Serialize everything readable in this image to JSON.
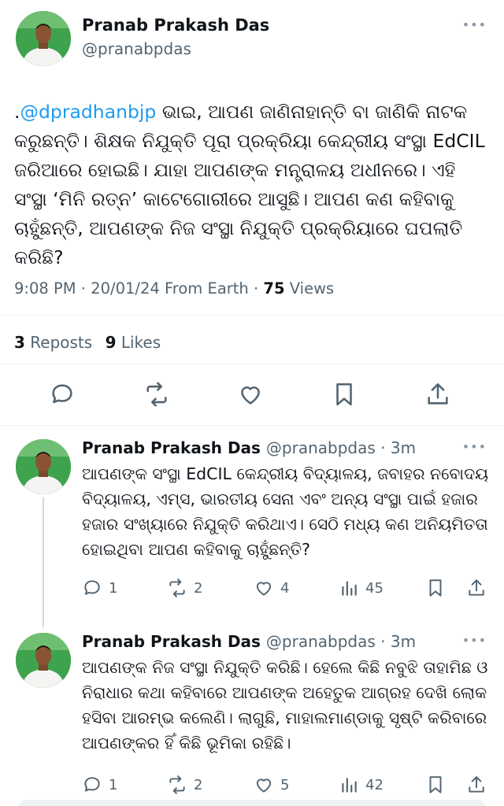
{
  "main_tweet": {
    "author_name": "Pranab Prakash Das",
    "author_handle": "@pranabpdas",
    "more_label": "•••",
    "text_prefix": ".",
    "mention": "@dpradhanbjp",
    "text_body": " ଭାଇ, ଆପଣ ଜାଣିନାହାନ୍ତି ବା ଜାଣିକି ନାଟକ କରୁଛନ୍ତି। ଶିକ୍ଷକ ନିଯୁକ୍ତି ପୂରା ପ୍ରକ୍ରିୟା କେନ୍ଦ୍ରୀୟ ସଂସ୍ଥା EdCIL ଜରିଆରେ ହୋଇଛି। ଯାହା ଆପଣଙ୍କ ମନ୍ତ୍ରାଳୟ ଅଧୀନରେ। ଏହି ସଂସ୍ଥା ‘ମିନି ରତ୍ନ’ କାଟେଗୋରୀରେ ଆସୁଛି। ଆପଣ କଣ କହିବାକୁ ଚାହୁଁଛନ୍ତି, ଆପଣଙ୍କ ନିଜ ସଂସ୍ଥା ନିଯୁକ୍ତି ପ୍ରକ୍ରିୟାରେ ଘପଲାତି କରିଛି?",
    "time": "9:08 PM",
    "date": "20/01/24",
    "source": "From Earth",
    "views_count": "75",
    "views_label": "Views",
    "reposts_count": "3",
    "reposts_label": "Reposts",
    "likes_count": "9",
    "likes_label": "Likes"
  },
  "replies": [
    {
      "author_name": "Pranab Prakash Das",
      "handle_time": "@pranabpdas · 3m",
      "text": "ଆପଣଙ୍କ ସଂସ୍ଥା EdCIL କେନ୍ଦ୍ରୀୟ ବିଦ୍ୟାଳୟ, ଜବାହର ନବୋଦୟ ବିଦ୍ୟାଳୟ, ଏମ୍ସ, ଭାରତୀୟ ସେନା ଏବଂ ଅନ୍ୟ ସଂସ୍ଥା ପାଇଁ ହଜାର ହଜାର ସଂଖ୍ୟାରେ ନିଯୁକ୍ତି କରିଥାଏ। ସେଠି ମଧ୍ୟ କଣ ଅନିୟମିତତା ହୋଇଥିବା ଆପଣ କହିବାକୁ ଚାହୁଁଛନ୍ତି?",
      "replies_count": "1",
      "reposts_count": "2",
      "likes_count": "4",
      "views_count": "45"
    },
    {
      "author_name": "Pranab Prakash Das",
      "handle_time": "@pranabpdas · 3m",
      "text": "ଆପଣଙ୍କ ନିଜ ସଂସ୍ଥା ନିଯୁକ୍ତି କରିଛି। ହେଲେ କିଛି ନବୁଝି ତାହାମିଛ ଓ ନିରାଧାର କଥା କହିବାରେ ଆପଣଙ୍କ ଅହେତୁକ ଆଗ୍ରହ ଦେଖି ଲୋକ ହସିବା ଆରମ୍ଭ କଲେଣି। ଲାଗୁଛି, ମାହାଲମାଣ୍ଡାକୁ ସୃଷ୍ଟି କରିବାରେ ଆପଣଙ୍କର ହିଁ କିଛି ଭୂମିକା ରହିଛି।",
      "replies_count": "1",
      "reposts_count": "2",
      "likes_count": "5",
      "views_count": "42"
    }
  ],
  "icons": {
    "reply": "reply-bubble-icon",
    "repost": "repost-arrows-icon",
    "like": "heart-icon",
    "bookmark": "bookmark-icon",
    "share": "share-upload-icon",
    "views": "bar-chart-icon",
    "more": "ellipsis-icon"
  },
  "colors": {
    "link": "#1d9bf0",
    "text": "#0f1419",
    "muted": "#536471",
    "icon": "#536471",
    "divider": "#eff3f4",
    "avatar_bg": "#4caf50"
  }
}
